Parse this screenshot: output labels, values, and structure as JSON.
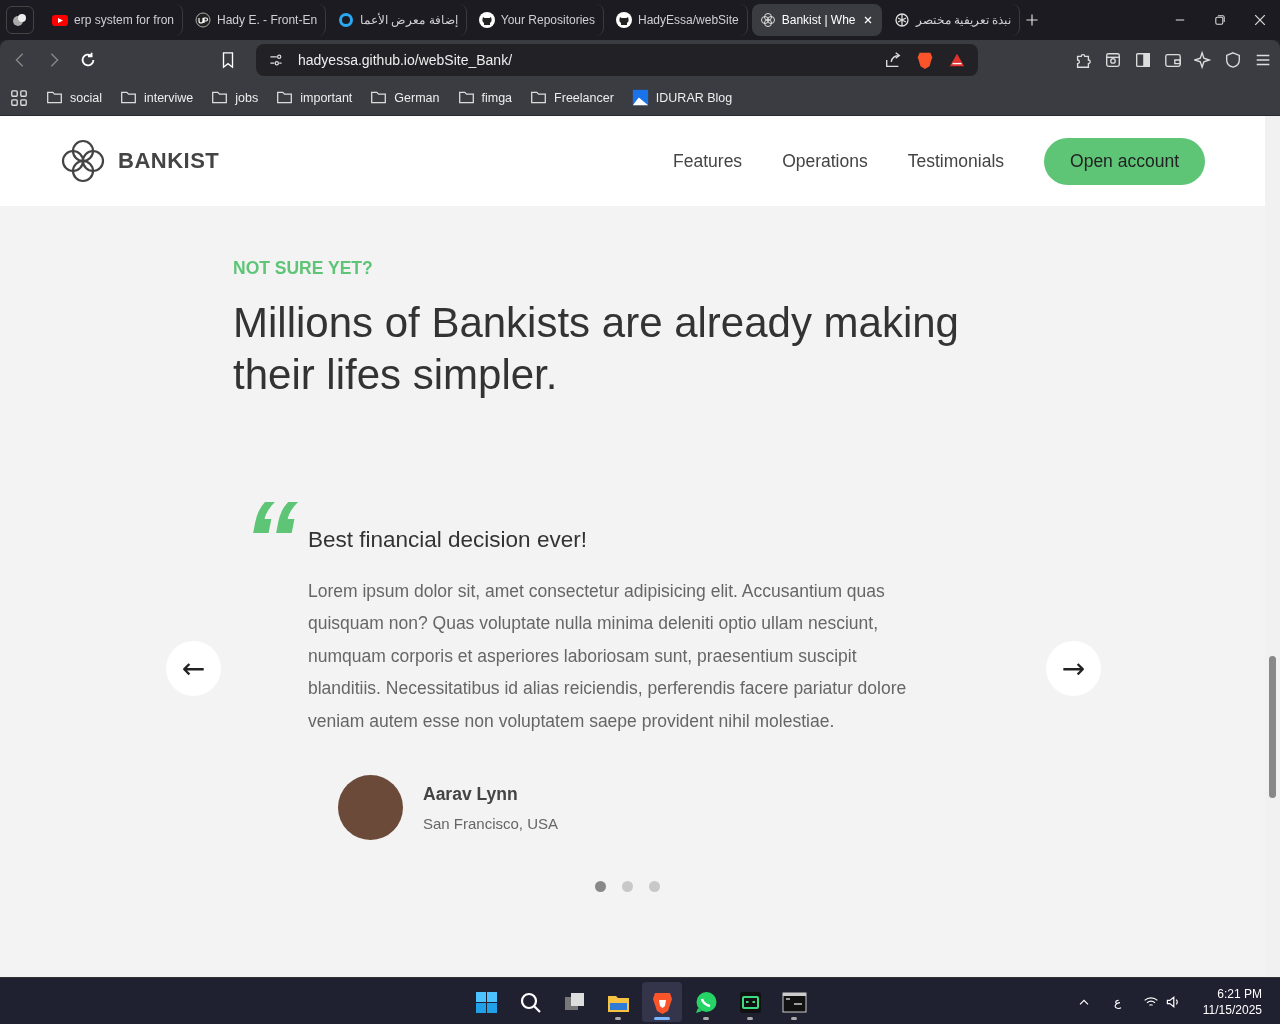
{
  "browser": {
    "tabs": [
      {
        "title": "erp system for fron",
        "kind": "video",
        "selected": false
      },
      {
        "title": "Hady E. - Front-En",
        "kind": "upwork",
        "selected": false
      },
      {
        "title": "إضافة معرض الأعما",
        "kind": "ring",
        "selected": false
      },
      {
        "title": "Your Repositories",
        "kind": "github",
        "selected": false
      },
      {
        "title": "HadyEssa/webSite",
        "kind": "github",
        "selected": false
      },
      {
        "title": "Bankist | Whe",
        "kind": "bankist",
        "selected": true
      },
      {
        "title": "نبذة تعريفية مختصر",
        "kind": "ai",
        "selected": false
      }
    ],
    "address": "hadyessa.github.io/webSite_Bank/",
    "bookmarks": [
      {
        "label": "social",
        "kind": "folder"
      },
      {
        "label": "interviwe",
        "kind": "folder"
      },
      {
        "label": "jobs",
        "kind": "folder"
      },
      {
        "label": "important",
        "kind": "folder"
      },
      {
        "label": "German",
        "kind": "folder"
      },
      {
        "label": "fimga",
        "kind": "folder"
      },
      {
        "label": "Freelancer",
        "kind": "folder"
      },
      {
        "label": "IDURAR Blog",
        "kind": "site"
      }
    ]
  },
  "page": {
    "logo": "BANKIST",
    "nav": [
      "Features",
      "Operations",
      "Testimonials"
    ],
    "cta": "Open account",
    "section": {
      "eyebrow": "NOT SURE YET?",
      "heading": "Millions of Bankists are already making their lifes simpler.",
      "quote_mark": "“",
      "testimonial": {
        "title": "Best financial decision ever!",
        "text": "Lorem ipsum dolor sit, amet consectetur adipisicing elit. Accusantium quas quisquam non? Quas voluptate nulla minima deleniti optio ullam nesciunt, numquam corporis et asperiores laboriosam sunt, praesentium suscipit blanditiis. Necessitatibus id alias reiciendis, perferendis facere pariatur dolore veniam autem esse non voluptatem saepe provident nihil molestiae.",
        "author": "Aarav Lynn",
        "location": "San Francisco, USA"
      },
      "prev": "←",
      "next": "→",
      "dots": [
        {
          "selected": true
        },
        {
          "selected": false
        },
        {
          "selected": false
        }
      ]
    }
  },
  "taskbar": {
    "apps": [
      {
        "kind": "start",
        "running": false,
        "selected": false
      },
      {
        "kind": "search",
        "running": false,
        "selected": false
      },
      {
        "kind": "taskview",
        "running": false,
        "selected": false
      },
      {
        "kind": "folder",
        "running": true,
        "selected": false
      },
      {
        "kind": "lion",
        "running": true,
        "selected": true
      },
      {
        "kind": "chat",
        "running": true,
        "selected": false
      },
      {
        "kind": "robot",
        "running": true,
        "selected": false
      },
      {
        "kind": "terminal",
        "running": true,
        "selected": false
      }
    ],
    "language": "ع",
    "time": "6:21 PM",
    "date": "11/15/2025"
  }
}
